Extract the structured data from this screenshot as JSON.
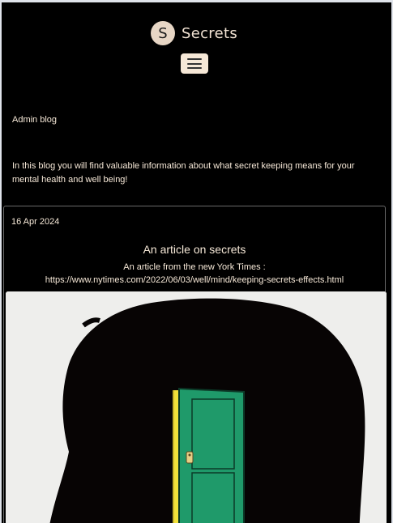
{
  "header": {
    "logo_letter": "S",
    "brand_name": "Secrets"
  },
  "blog": {
    "title": "Admin blog",
    "intro": "In this blog you will find valuable information about what secret keeping means for your mental health and well being!"
  },
  "post": {
    "date": "16 Apr 2024",
    "title": "An article on secrets",
    "description": "An article from the new York Times : https://www.nytimes.com/2022/06/03/well/mind/keeping-secrets-effects.html"
  },
  "colors": {
    "background": "#000000",
    "text": "#f6e8d7",
    "logo_circle": "#e7d6c5",
    "door_green": "#1f9a6a",
    "door_frame": "#f2e13a"
  }
}
